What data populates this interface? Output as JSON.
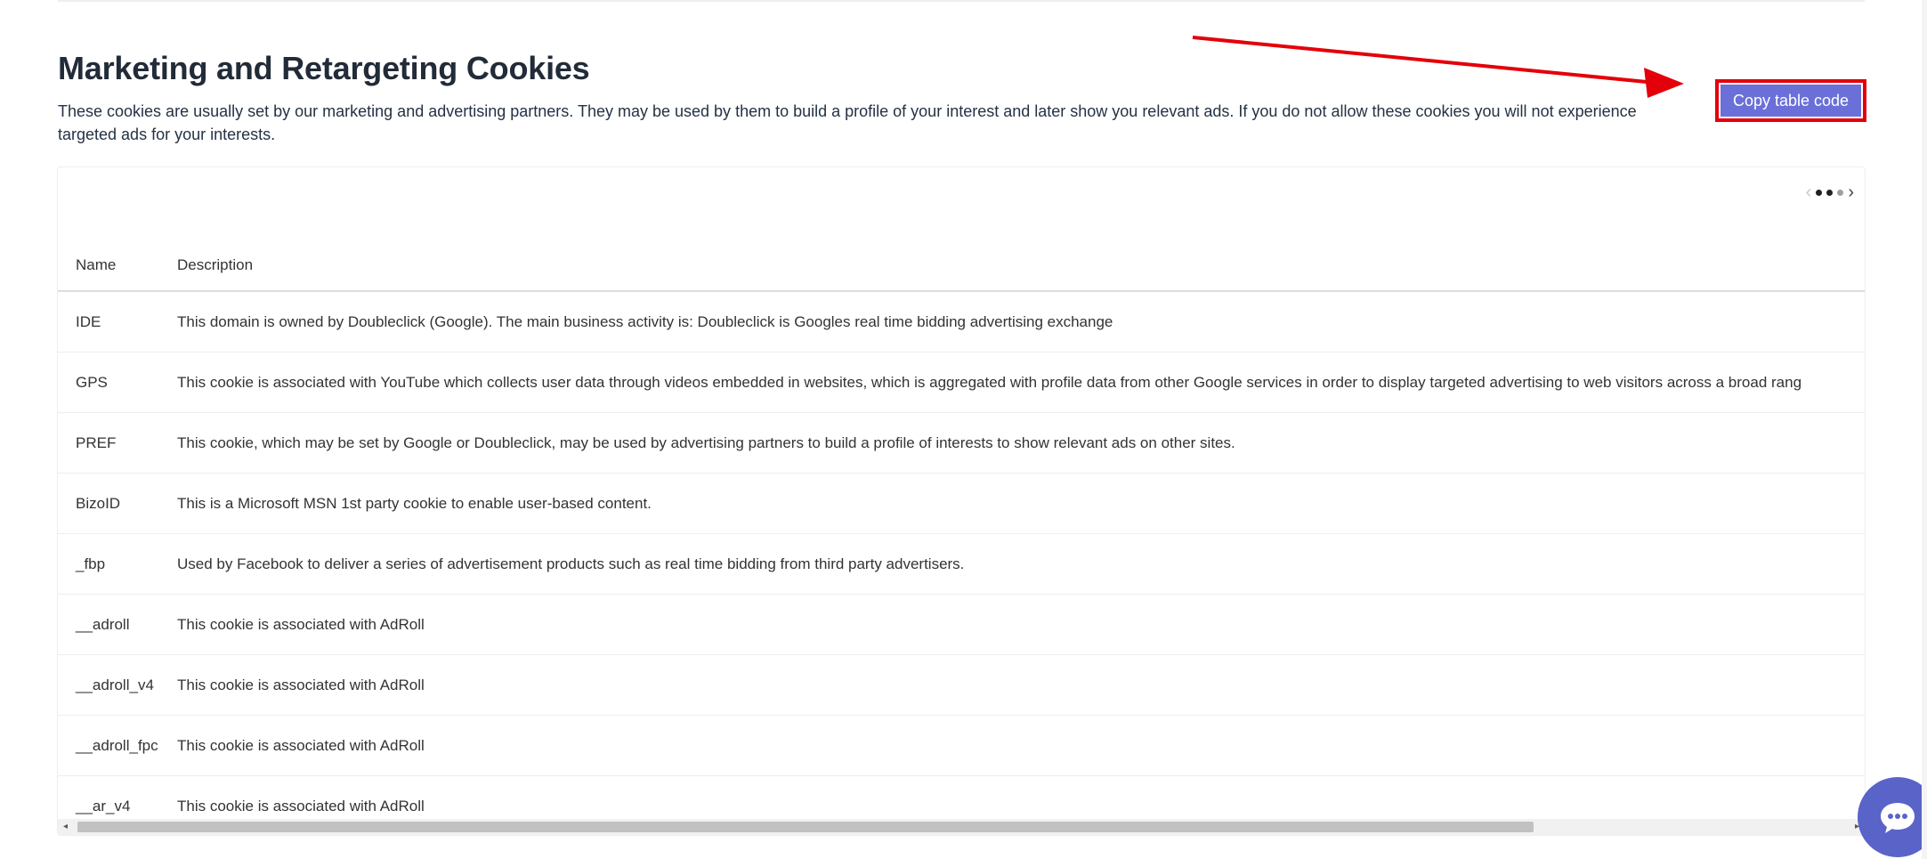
{
  "section": {
    "title": "Marketing and Retargeting Cookies",
    "description": "These cookies are usually set by our marketing and advertising partners. They may be used by them to build a profile of your interest and later show you relevant ads. If you do not allow these cookies you will not experience targeted ads for your interests."
  },
  "copy_button": {
    "label": "Copy table code"
  },
  "colors": {
    "accent": "#6a70d8",
    "highlight": "#e3000b",
    "chat": "#5a63c8"
  },
  "table": {
    "headers": [
      "Name",
      "Description"
    ],
    "rows": [
      {
        "name": "IDE",
        "description": "This domain is owned by Doubleclick (Google). The main business activity is: Doubleclick is Googles real time bidding advertising exchange"
      },
      {
        "name": "GPS",
        "description": "This cookie is associated with YouTube which collects user data through videos embedded in websites, which is aggregated with profile data from other Google services in order to display targeted advertising to web visitors across a broad rang"
      },
      {
        "name": "PREF",
        "description": "This cookie, which may be set by Google or Doubleclick, may be used by advertising partners to build a profile of interests to show relevant ads on other sites."
      },
      {
        "name": "BizoID",
        "description": "This is a Microsoft MSN 1st party cookie to enable user-based content."
      },
      {
        "name": "_fbp",
        "description": "Used by Facebook to deliver a series of advertisement products such as real time bidding from third party advertisers."
      },
      {
        "name": "__adroll",
        "description": "This cookie is associated with AdRoll"
      },
      {
        "name": "__adroll_v4",
        "description": "This cookie is associated with AdRoll"
      },
      {
        "name": "__adroll_fpc",
        "description": "This cookie is associated with AdRoll"
      },
      {
        "name": "__ar_v4",
        "description": "This cookie is associated with AdRoll"
      }
    ]
  },
  "icons": {
    "pager_prev": "chevron-left-icon",
    "pager_next": "chevron-right-icon",
    "chat": "chat-bubble-icon",
    "annotation": "red-arrow-annotation"
  }
}
